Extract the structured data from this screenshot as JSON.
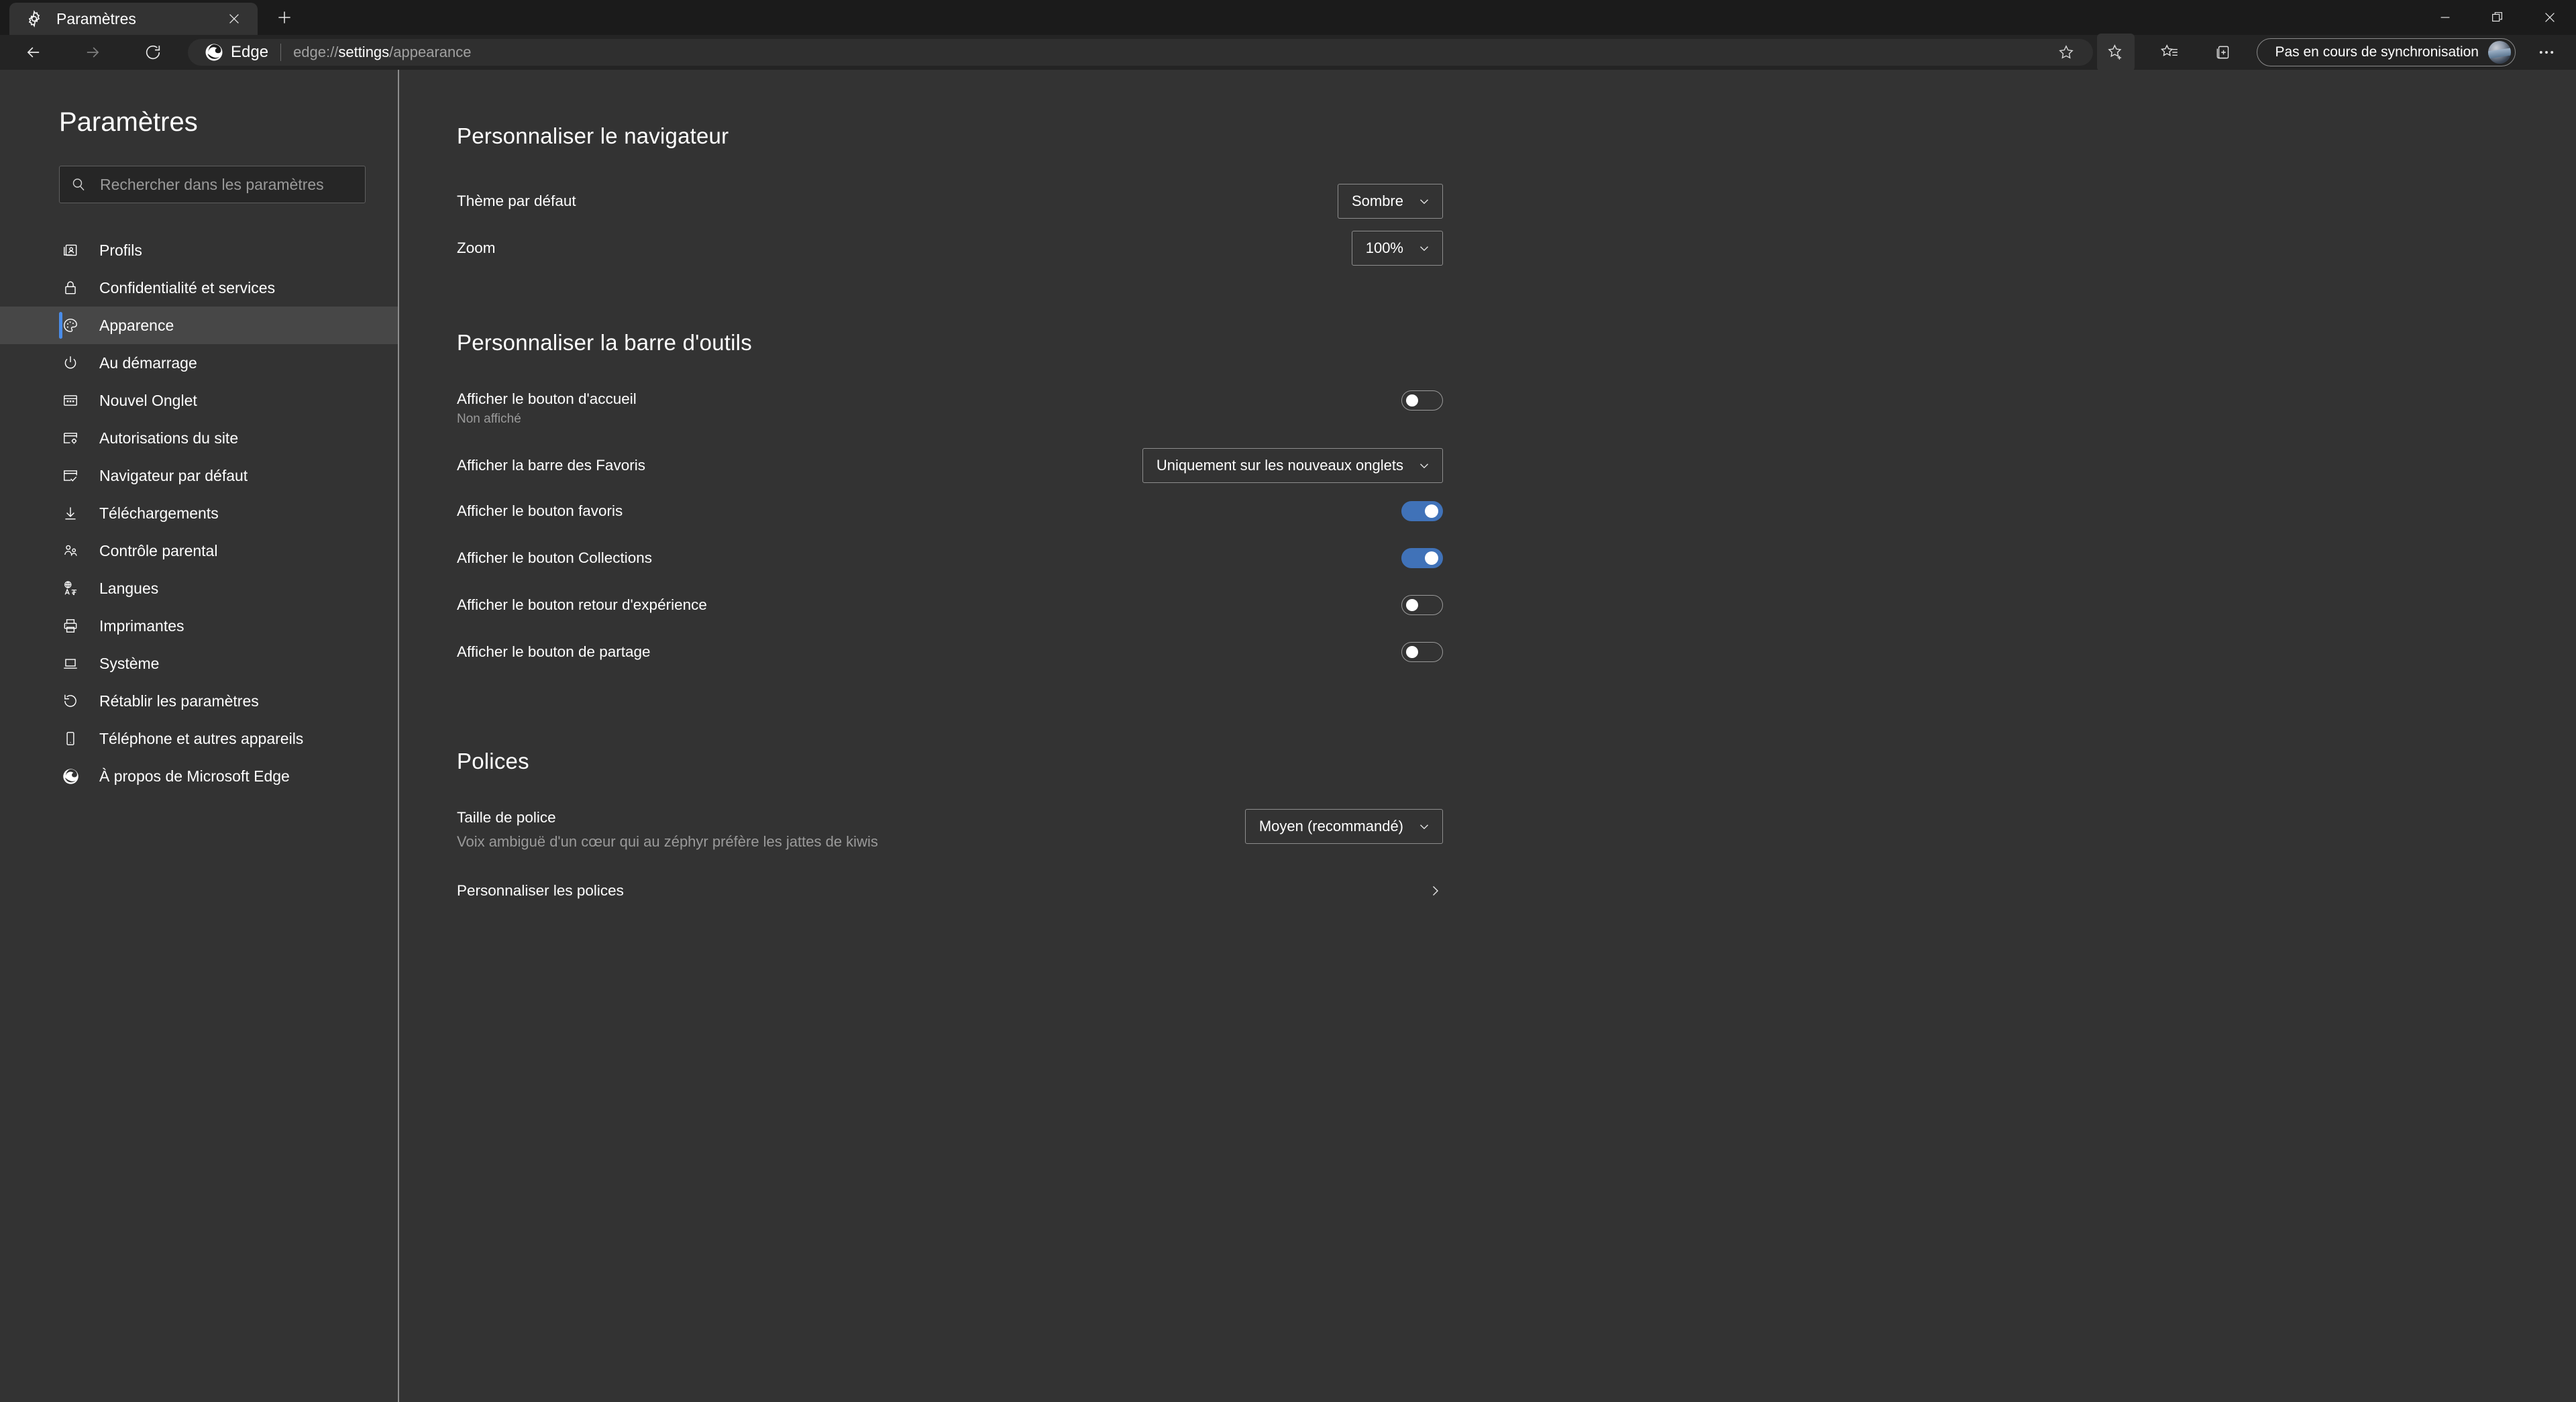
{
  "window": {
    "tab": {
      "title": "Paramètres",
      "favicon": "gear-icon"
    },
    "new_tab_label": "+",
    "controls": {
      "minimize": "—",
      "restore": "❐",
      "close": "✕"
    }
  },
  "toolbar": {
    "back": "back-arrow-icon",
    "forward": "forward-arrow-icon",
    "reload": "reload-icon",
    "brand": "Edge",
    "url_prefix": "edge://",
    "url_bold": "settings",
    "url_suffix": "/appearance",
    "favorites_star": "star-add-icon",
    "favorites_list": "favorites-list-icon",
    "collections": "collections-icon",
    "sync_status": "Pas en cours de synchronisation",
    "more": "···"
  },
  "sidebar": {
    "title": "Paramètres",
    "search": {
      "placeholder": "Rechercher dans les paramètres",
      "value": ""
    },
    "items": [
      {
        "label": "Profils",
        "icon": "profile-card-icon",
        "active": false
      },
      {
        "label": "Confidentialité et services",
        "icon": "lock-icon",
        "active": false
      },
      {
        "label": "Apparence",
        "icon": "palette-icon",
        "active": true
      },
      {
        "label": "Au démarrage",
        "icon": "power-icon",
        "active": false
      },
      {
        "label": "Nouvel Onglet",
        "icon": "new-tab-icon",
        "active": false
      },
      {
        "label": "Autorisations du site",
        "icon": "site-permissions-icon",
        "active": false
      },
      {
        "label": "Navigateur par défaut",
        "icon": "default-browser-icon",
        "active": false
      },
      {
        "label": "Téléchargements",
        "icon": "download-arrow-icon",
        "active": false
      },
      {
        "label": "Contrôle parental",
        "icon": "family-icon",
        "active": false
      },
      {
        "label": "Langues",
        "icon": "languages-icon",
        "active": false
      },
      {
        "label": "Imprimantes",
        "icon": "printer-icon",
        "active": false
      },
      {
        "label": "Système",
        "icon": "laptop-icon",
        "active": false
      },
      {
        "label": "Rétablir les paramètres",
        "icon": "reset-icon",
        "active": false
      },
      {
        "label": "Téléphone et autres appareils",
        "icon": "phone-icon",
        "active": false
      },
      {
        "label": "À propos de Microsoft Edge",
        "icon": "edge-logo-icon",
        "active": false
      }
    ]
  },
  "main": {
    "section_browser": {
      "title": "Personnaliser le navigateur",
      "theme": {
        "label": "Thème par défaut",
        "value": "Sombre"
      },
      "zoom": {
        "label": "Zoom",
        "value": "100%"
      }
    },
    "section_toolbar": {
      "title": "Personnaliser la barre d'outils",
      "home_button": {
        "label": "Afficher le bouton d'accueil",
        "sub": "Non affiché",
        "state": "off"
      },
      "favorites_bar": {
        "label": "Afficher la barre des Favoris",
        "value": "Uniquement sur les nouveaux onglets"
      },
      "favorites_button": {
        "label": "Afficher le bouton favoris",
        "state": "on"
      },
      "collections_button": {
        "label": "Afficher le bouton Collections",
        "state": "on"
      },
      "feedback_button": {
        "label": "Afficher le bouton retour d'expérience",
        "state": "off"
      },
      "share_button": {
        "label": "Afficher le bouton de partage",
        "state": "off"
      }
    },
    "section_fonts": {
      "title": "Polices",
      "font_size": {
        "label": "Taille de police",
        "value": "Moyen (recommandé)"
      },
      "sample": "Voix ambiguë d'un cœur qui au zéphyr préfère les jattes de kiwis",
      "customize": {
        "label": "Personnaliser les polices",
        "chevron": "›"
      }
    }
  },
  "colors": {
    "accent": "#4072b8",
    "active_indicator": "#4a8ce8",
    "page_bg": "#333333",
    "toolbar_bg": "#242424",
    "titlebar_bg": "#1b1b1b"
  }
}
